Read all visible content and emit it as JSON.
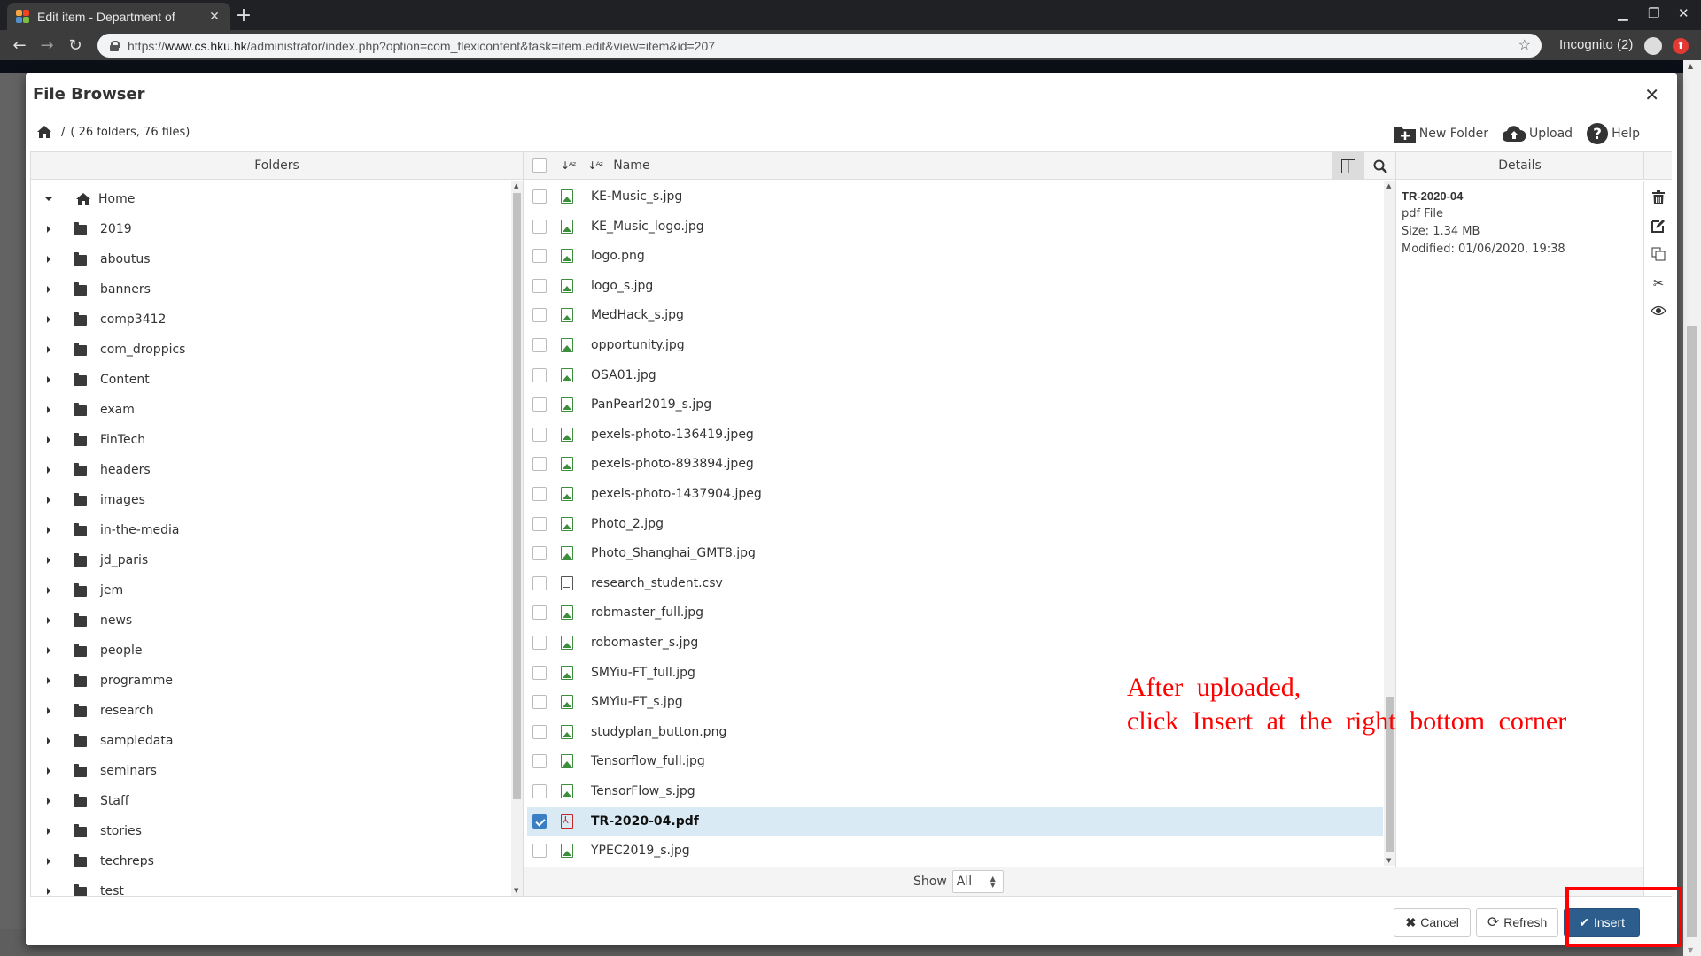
{
  "browser": {
    "tab_title": "Edit item - Department of",
    "url_scheme": "https://",
    "url_host": "www.cs.hku.hk",
    "url_path": "/administrator/index.php?option=com_flexicontent&task=item.edit&view=item&id=207",
    "profile_label": "Incognito (2)"
  },
  "modal": {
    "title": "File Browser",
    "breadcrumb": {
      "path": "/",
      "summary": "( 26 folders, 76 files)"
    },
    "toolbar": {
      "new_folder": "New Folder",
      "upload": "Upload",
      "help": "Help"
    },
    "folders_header": "Folders",
    "files_header": "Name",
    "details_header": "Details",
    "folders": [
      {
        "name": "Home",
        "expanded": true,
        "icon": "home-icon"
      },
      {
        "name": "2019"
      },
      {
        "name": "aboutus"
      },
      {
        "name": "banners"
      },
      {
        "name": "comp3412"
      },
      {
        "name": "com_droppics"
      },
      {
        "name": "Content"
      },
      {
        "name": "exam"
      },
      {
        "name": "FinTech"
      },
      {
        "name": "headers"
      },
      {
        "name": "images"
      },
      {
        "name": "in-the-media"
      },
      {
        "name": "jd_paris"
      },
      {
        "name": "jem"
      },
      {
        "name": "news"
      },
      {
        "name": "people"
      },
      {
        "name": "programme"
      },
      {
        "name": "research"
      },
      {
        "name": "sampledata"
      },
      {
        "name": "seminars"
      },
      {
        "name": "Staff"
      },
      {
        "name": "stories"
      },
      {
        "name": "techreps"
      },
      {
        "name": "test"
      }
    ],
    "files": [
      {
        "name": "KE-Music_s.jpg",
        "type": "img",
        "checked": false
      },
      {
        "name": "KE_Music_logo.jpg",
        "type": "img",
        "checked": false
      },
      {
        "name": "logo.png",
        "type": "img",
        "checked": false
      },
      {
        "name": "logo_s.jpg",
        "type": "img",
        "checked": false
      },
      {
        "name": "MedHack_s.jpg",
        "type": "img",
        "checked": false
      },
      {
        "name": "opportunity.jpg",
        "type": "img",
        "checked": false
      },
      {
        "name": "OSA01.jpg",
        "type": "img",
        "checked": false
      },
      {
        "name": "PanPearl2019_s.jpg",
        "type": "img",
        "checked": false
      },
      {
        "name": "pexels-photo-136419.jpeg",
        "type": "img",
        "checked": false
      },
      {
        "name": "pexels-photo-893894.jpeg",
        "type": "img",
        "checked": false
      },
      {
        "name": "pexels-photo-1437904.jpeg",
        "type": "img",
        "checked": false
      },
      {
        "name": "Photo_2.jpg",
        "type": "img",
        "checked": false
      },
      {
        "name": "Photo_Shanghai_GMT8.jpg",
        "type": "img",
        "checked": false
      },
      {
        "name": "research_student.csv",
        "type": "txt",
        "checked": false
      },
      {
        "name": "robmaster_full.jpg",
        "type": "img",
        "checked": false
      },
      {
        "name": "robomaster_s.jpg",
        "type": "img",
        "checked": false
      },
      {
        "name": "SMYiu-FT_full.jpg",
        "type": "img",
        "checked": false
      },
      {
        "name": "SMYiu-FT_s.jpg",
        "type": "img",
        "checked": false
      },
      {
        "name": "studyplan_button.png",
        "type": "img",
        "checked": false
      },
      {
        "name": "Tensorflow_full.jpg",
        "type": "img",
        "checked": false
      },
      {
        "name": "TensorFlow_s.jpg",
        "type": "img",
        "checked": false
      },
      {
        "name": "TR-2020-04.pdf",
        "type": "pdf",
        "checked": true
      },
      {
        "name": "YPEC2019_s.jpg",
        "type": "img",
        "checked": false
      }
    ],
    "show_label": "Show",
    "show_value": "All",
    "details": {
      "name": "TR-2020-04",
      "type": "pdf File",
      "size": "Size: 1.34 MB",
      "modified": "Modified: 01/06/2020, 19:38"
    },
    "buttons": {
      "cancel": "Cancel",
      "refresh": "Refresh",
      "insert": "Insert"
    }
  },
  "annotation": {
    "line1": "After uploaded,",
    "line2": "click Insert at the right bottom corner",
    "color": "#ff0000"
  },
  "colors": {
    "primary_button": "#2d5d8c",
    "selected_row": "#d9eaf5",
    "image_icon": "#3c8d3c",
    "pdf_icon": "#c62828"
  }
}
